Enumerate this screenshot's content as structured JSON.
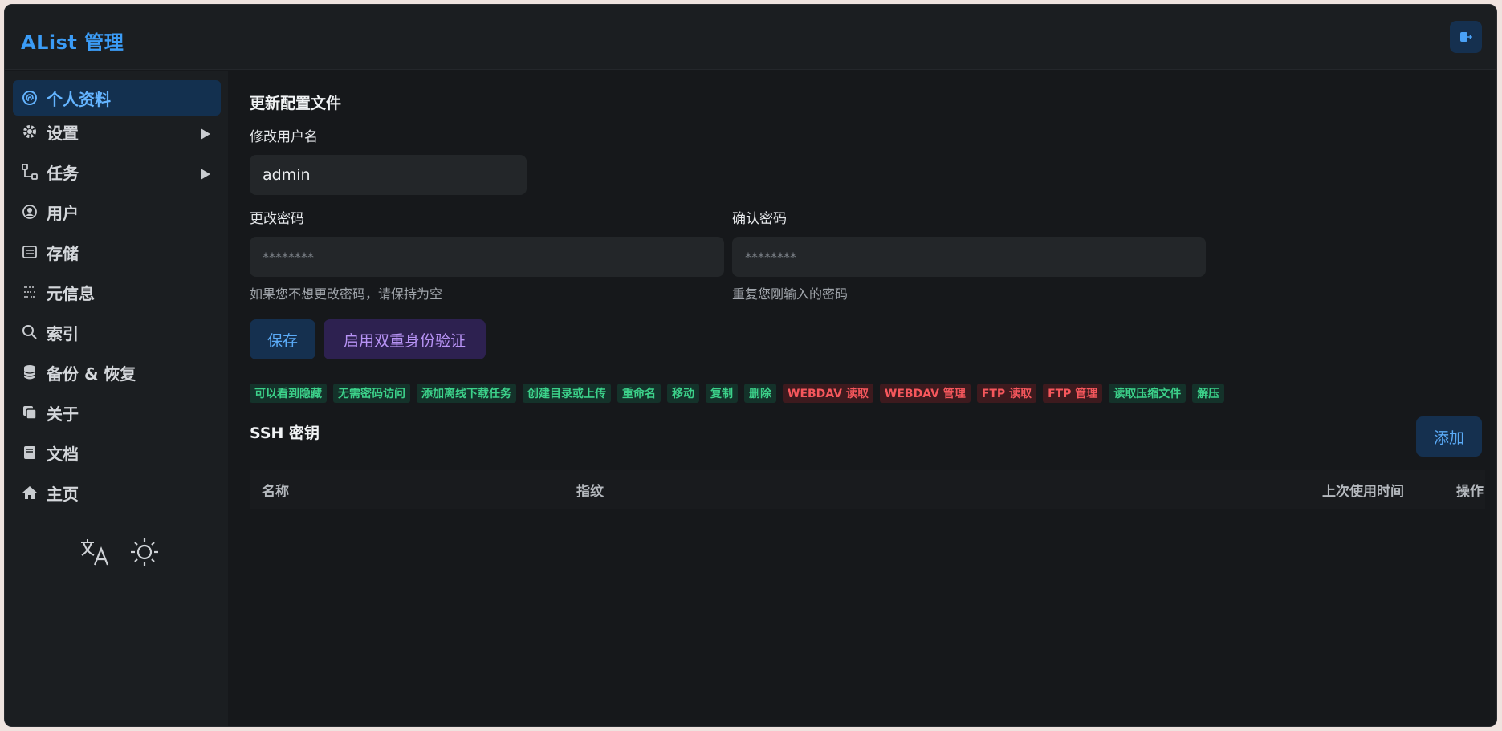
{
  "app": {
    "title": "AList 管理"
  },
  "header": {
    "logout_icon": "logout-icon"
  },
  "sidebar": {
    "items": [
      {
        "label": "个人资料",
        "icon": "fingerprint-icon",
        "active": true,
        "expandable": false
      },
      {
        "label": "设置",
        "icon": "gear-icon",
        "active": false,
        "expandable": true
      },
      {
        "label": "任务",
        "icon": "workflow-icon",
        "active": false,
        "expandable": true
      },
      {
        "label": "用户",
        "icon": "user-icon",
        "active": false,
        "expandable": false
      },
      {
        "label": "存储",
        "icon": "storage-icon",
        "active": false,
        "expandable": false
      },
      {
        "label": "元信息",
        "icon": "meta-icon",
        "active": false,
        "expandable": false
      },
      {
        "label": "索引",
        "icon": "search-icon",
        "active": false,
        "expandable": false
      },
      {
        "label": "备份 & 恢复",
        "icon": "database-icon",
        "active": false,
        "expandable": false
      },
      {
        "label": "关于",
        "icon": "copy-icon",
        "active": false,
        "expandable": false
      },
      {
        "label": "文档",
        "icon": "book-icon",
        "active": false,
        "expandable": false
      },
      {
        "label": "主页",
        "icon": "home-icon",
        "active": false,
        "expandable": false
      }
    ],
    "bottom_icons": [
      "translate-icon",
      "sun-icon"
    ]
  },
  "profile": {
    "section_title": "更新配置文件",
    "username_label": "修改用户名",
    "username_value": "admin",
    "password_label": "更改密码",
    "password_placeholder": "********",
    "password_hint": "如果您不想更改密码，请保持为空",
    "confirm_label": "确认密码",
    "confirm_placeholder": "********",
    "confirm_hint": "重复您刚输入的密码",
    "save_label": "保存",
    "twofa_label": "启用双重身份验证"
  },
  "permissions": [
    {
      "label": "可以看到隐藏",
      "allowed": true
    },
    {
      "label": "无需密码访问",
      "allowed": true
    },
    {
      "label": "添加离线下载任务",
      "allowed": true
    },
    {
      "label": "创建目录或上传",
      "allowed": true
    },
    {
      "label": "重命名",
      "allowed": true
    },
    {
      "label": "移动",
      "allowed": true
    },
    {
      "label": "复制",
      "allowed": true
    },
    {
      "label": "删除",
      "allowed": true
    },
    {
      "label": "WEBDAV 读取",
      "allowed": false
    },
    {
      "label": "WEBDAV 管理",
      "allowed": false
    },
    {
      "label": "FTP 读取",
      "allowed": false
    },
    {
      "label": "FTP 管理",
      "allowed": false
    },
    {
      "label": "读取压缩文件",
      "allowed": true
    },
    {
      "label": "解压",
      "allowed": true
    }
  ],
  "ssh": {
    "title": "SSH 密钥",
    "add_label": "添加",
    "columns": {
      "name": "名称",
      "fingerprint": "指纹",
      "last_used": "上次使用时间",
      "actions": "操作"
    }
  },
  "colors": {
    "accent": "#3b9cf6",
    "allowed": "#3cd18a",
    "denied": "#f6575c",
    "twofa": "#b793f5"
  }
}
